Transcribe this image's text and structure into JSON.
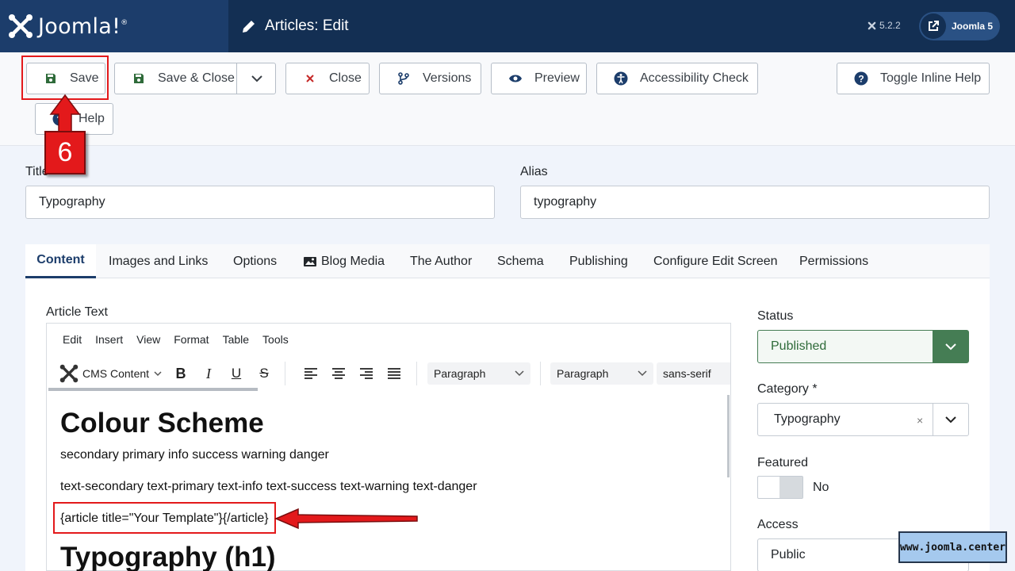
{
  "header": {
    "brand": "Joomla!",
    "page_title": "Articles: Edit",
    "version": "5.2.2",
    "site_button": "Joomla 5"
  },
  "toolbar": {
    "save": "Save",
    "save_close": "Save & Close",
    "close": "Close",
    "versions": "Versions",
    "preview": "Preview",
    "accessibility": "Accessibility Check",
    "toggle_help": "Toggle Inline Help",
    "help": "Help"
  },
  "form": {
    "title_label": "Title",
    "title_value": "Typography",
    "alias_label": "Alias",
    "alias_value": "typography"
  },
  "tabs": [
    "Content",
    "Images and Links",
    "Options",
    "Blog Media",
    "The Author",
    "Schema",
    "Publishing",
    "Configure Edit Screen",
    "Permissions"
  ],
  "editor": {
    "label": "Article Text",
    "menu": [
      "Edit",
      "Insert",
      "View",
      "Format",
      "Table",
      "Tools"
    ],
    "cms_content": "CMS Content",
    "block_format": "Paragraph",
    "paragraph2": "Paragraph",
    "font_family": "sans-serif",
    "heading": "Colour Scheme",
    "line1": "secondary primary info success warning danger",
    "line2": "text-secondary text-primary text-info text-success text-warning text-danger",
    "line3": "{article title=\"Your Template\"}{/article}",
    "heading2": "Typography (h1)"
  },
  "sidebar": {
    "status_label": "Status",
    "status_value": "Published",
    "category_label": "Category *",
    "category_value": "Typography",
    "featured_label": "Featured",
    "featured_value": "No",
    "access_label": "Access",
    "access_value": "Public"
  },
  "annotation": {
    "step": "6",
    "watermark": "www.joomla.center"
  },
  "colors": {
    "header_bg": "#132f53",
    "brand_bg": "#1c3d6b",
    "status_green": "#457d54",
    "highlight_red": "#e3191b"
  }
}
